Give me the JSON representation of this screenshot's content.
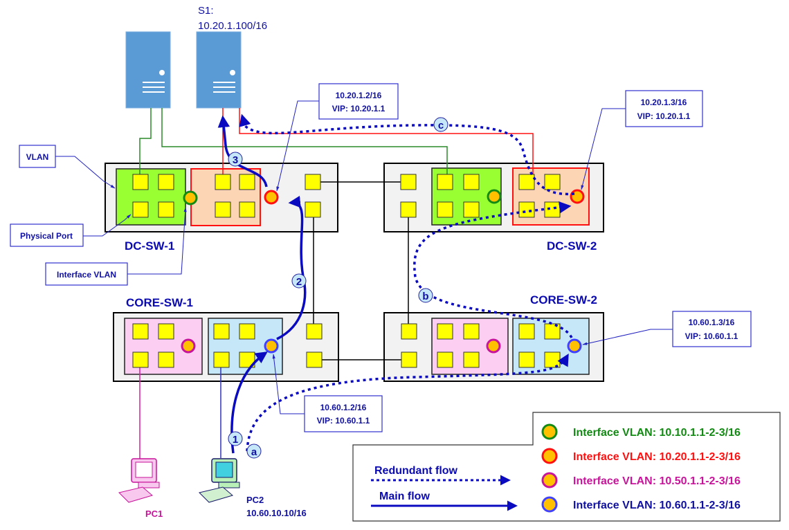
{
  "server": {
    "name": "S1:",
    "ip": "10.20.1.100/16"
  },
  "switches": {
    "dc1": "DC-SW-1",
    "dc2": "DC-SW-2",
    "core1": "CORE-SW-1",
    "core2": "CORE-SW-2"
  },
  "callouts": {
    "vlan": "VLAN",
    "physical_port": "Physical Port",
    "interface_vlan": "Interface VLAN",
    "dc1": {
      "ip": "10.20.1.2/16",
      "vip": "VIP: 10.20.1.1"
    },
    "dc2": {
      "ip": "10.20.1.3/16",
      "vip": "VIP: 10.20.1.1"
    },
    "core1": {
      "ip": "10.60.1.2/16",
      "vip": "VIP: 10.60.1.1"
    },
    "core2": {
      "ip": "10.60.1.3/16",
      "vip": "VIP: 10.60.1.1"
    }
  },
  "pcs": {
    "pc1": "PC1",
    "pc2": "PC2",
    "pc2_ip": "10.60.10.10/16"
  },
  "steps": {
    "s1": "1",
    "s2": "2",
    "s3": "3",
    "a": "a",
    "b": "b",
    "c": "c"
  },
  "legend": {
    "redundant": "Redundant  flow",
    "main": "Main flow",
    "vlans": [
      {
        "label": "Interface VLAN: 10.10.1.1-2-3/16",
        "color": "#138a13"
      },
      {
        "label": "Interface VLAN: 10.20.1.1-2-3/16",
        "color": "#ff1010"
      },
      {
        "label": "Interface VLAN: 10.50.1.1-2-3/16",
        "color": "#c8149a"
      },
      {
        "label": "Interface VLAN: 10.60.1.1-2-3/16",
        "color": "#1010a0"
      }
    ]
  },
  "colors": {
    "flow": "#0a0ac0",
    "port": "#ffff00",
    "vlan10": "#99ff33",
    "vlan20": "#fcd5b5",
    "vlan50": "#fccff2",
    "vlan60": "#c6e7f7",
    "server": "#5b9bd5"
  }
}
